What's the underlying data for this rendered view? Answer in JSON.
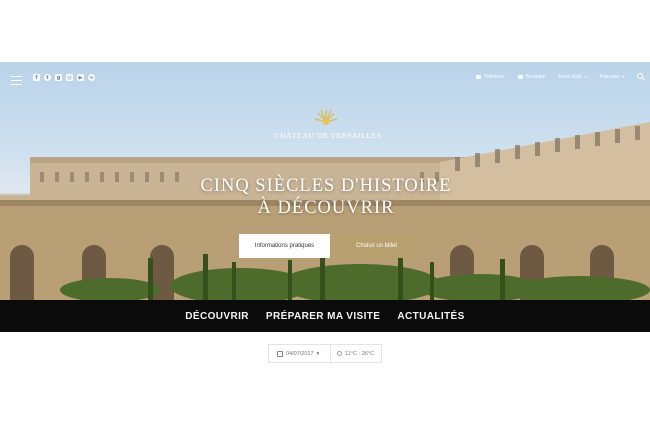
{
  "top_bar": {
    "social_icons": [
      "facebook-icon",
      "twitter-icon",
      "google-plus-icon",
      "instagram-icon",
      "youtube-icon",
      "wechat-icon"
    ],
    "nav": [
      {
        "label": "Billetterie",
        "icon": "ticket-icon"
      },
      {
        "label": "Boutique",
        "icon": "shop-icon"
      },
      {
        "label": "Nous Rejo",
        "icon": "none",
        "caret": "▾"
      },
      {
        "label": "Français",
        "icon": "none",
        "caret": "▾"
      }
    ]
  },
  "hero": {
    "logo_text": "CHÂTEAU DE VERSAILLES",
    "headline_line1": "Cinq siècles d'histoire",
    "headline_line2": "à découvrir",
    "cta_info": "Informations pratiques",
    "cta_ticket": "Choisir un billet",
    "colors": {
      "ticket_button": "#b79f6e",
      "nav_bg": "#0b0b0b"
    }
  },
  "main_nav": [
    "DÉCOUVRIR",
    "PRÉPARER MA VISITE",
    "ACTUALITÉS"
  ],
  "widget": {
    "date": "04/07/2017",
    "date_caret": "▾",
    "weather": "11°C · 26°C"
  }
}
